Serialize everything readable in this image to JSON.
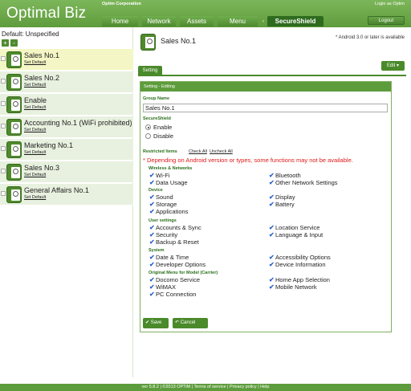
{
  "header": {
    "logo": "Optimal Biz",
    "company": "Optim Corporation",
    "login": "Login as Optim",
    "logout": "Logout",
    "nav": [
      "Home",
      "Network",
      "Assets",
      "Menu",
      "SecureShield"
    ],
    "nav_sep": "›"
  },
  "sidebar": {
    "default_label": "Default: Unspecified",
    "add_icon": "+",
    "remove_icon": "-",
    "set_default": "Set Default",
    "groups": [
      {
        "name": "Sales No.1"
      },
      {
        "name": "Sales No.2"
      },
      {
        "name": "Enable"
      },
      {
        "name": "Accounting No.1 (WiFi prohibited)"
      },
      {
        "name": "Marketing No.1"
      },
      {
        "name": "Sales No.3"
      },
      {
        "name": "General Affairs No.1"
      }
    ]
  },
  "main": {
    "title": "Sales No.1",
    "android_note": "* Android 3.0 or later is available",
    "setting_tab": "Setting",
    "edit_button": "Edit ▾",
    "panel_title": "Setting - Editing",
    "group_name_label": "Group Name",
    "group_name_value": "Sales No.1",
    "secureshield_label": "SecureShield",
    "enable": "Enable",
    "disable": "Disable",
    "restricted_label": "Restricted Items",
    "check_all": "Check All",
    "uncheck_all": "Uncheck All",
    "warning": "* Depending on Android version or types, some functions may not be available.",
    "categories": {
      "wireless": "Wireless & Networks",
      "device": "Device",
      "user": "User settings",
      "system": "System",
      "carrier": "Original Menu for Model (Carrier)"
    },
    "items": {
      "wifi": "Wi-Fi",
      "bluetooth": "Bluetooth",
      "data_usage": "Data Usage",
      "other_network": "Other Network Settings",
      "sound": "Sound",
      "display": "Display",
      "storage": "Storage",
      "battery": "Battery",
      "applications": "Applications",
      "accounts": "Accounts & Sync",
      "location": "Location Service",
      "security": "Security",
      "language": "Language & Input",
      "backup": "Backup & Reset",
      "datetime": "Date & Time",
      "accessibility": "Accessibility Options",
      "developer": "Developer Options",
      "device_info": "Device Information",
      "docomo": "Docomo Service",
      "home_app": "Home App Selection",
      "wimax": "WiMAX",
      "mobile_network": "Mobile Network",
      "pc_connection": "PC Connection"
    },
    "save": "✔ Save",
    "cancel": "↶ Cancel"
  },
  "footer": "ver 5.8.2 | ©2013 OPTiM | Terms of service | Privacy policy | Help"
}
